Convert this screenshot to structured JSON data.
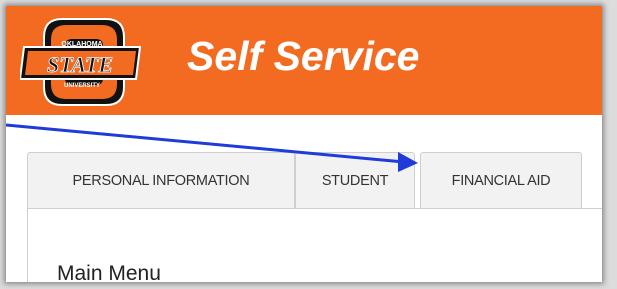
{
  "header": {
    "title": "Self Service",
    "logo": {
      "top_text": "OKLAHOMA",
      "main_text": "STATE",
      "bottom_text": "UNIVERSITY"
    }
  },
  "tabs": [
    {
      "label": "PERSONAL INFORMATION"
    },
    {
      "label": "STUDENT"
    },
    {
      "label": "FINANCIAL AID"
    }
  ],
  "main": {
    "panel_title": "Main Menu"
  },
  "annotation": {
    "arrow_icon": "annotation-arrow-icon",
    "arrow_color": "#1f3bd8"
  },
  "colors": {
    "brand": "#f26b21",
    "logo_orange": "#f26b21",
    "logo_black": "#111111"
  }
}
